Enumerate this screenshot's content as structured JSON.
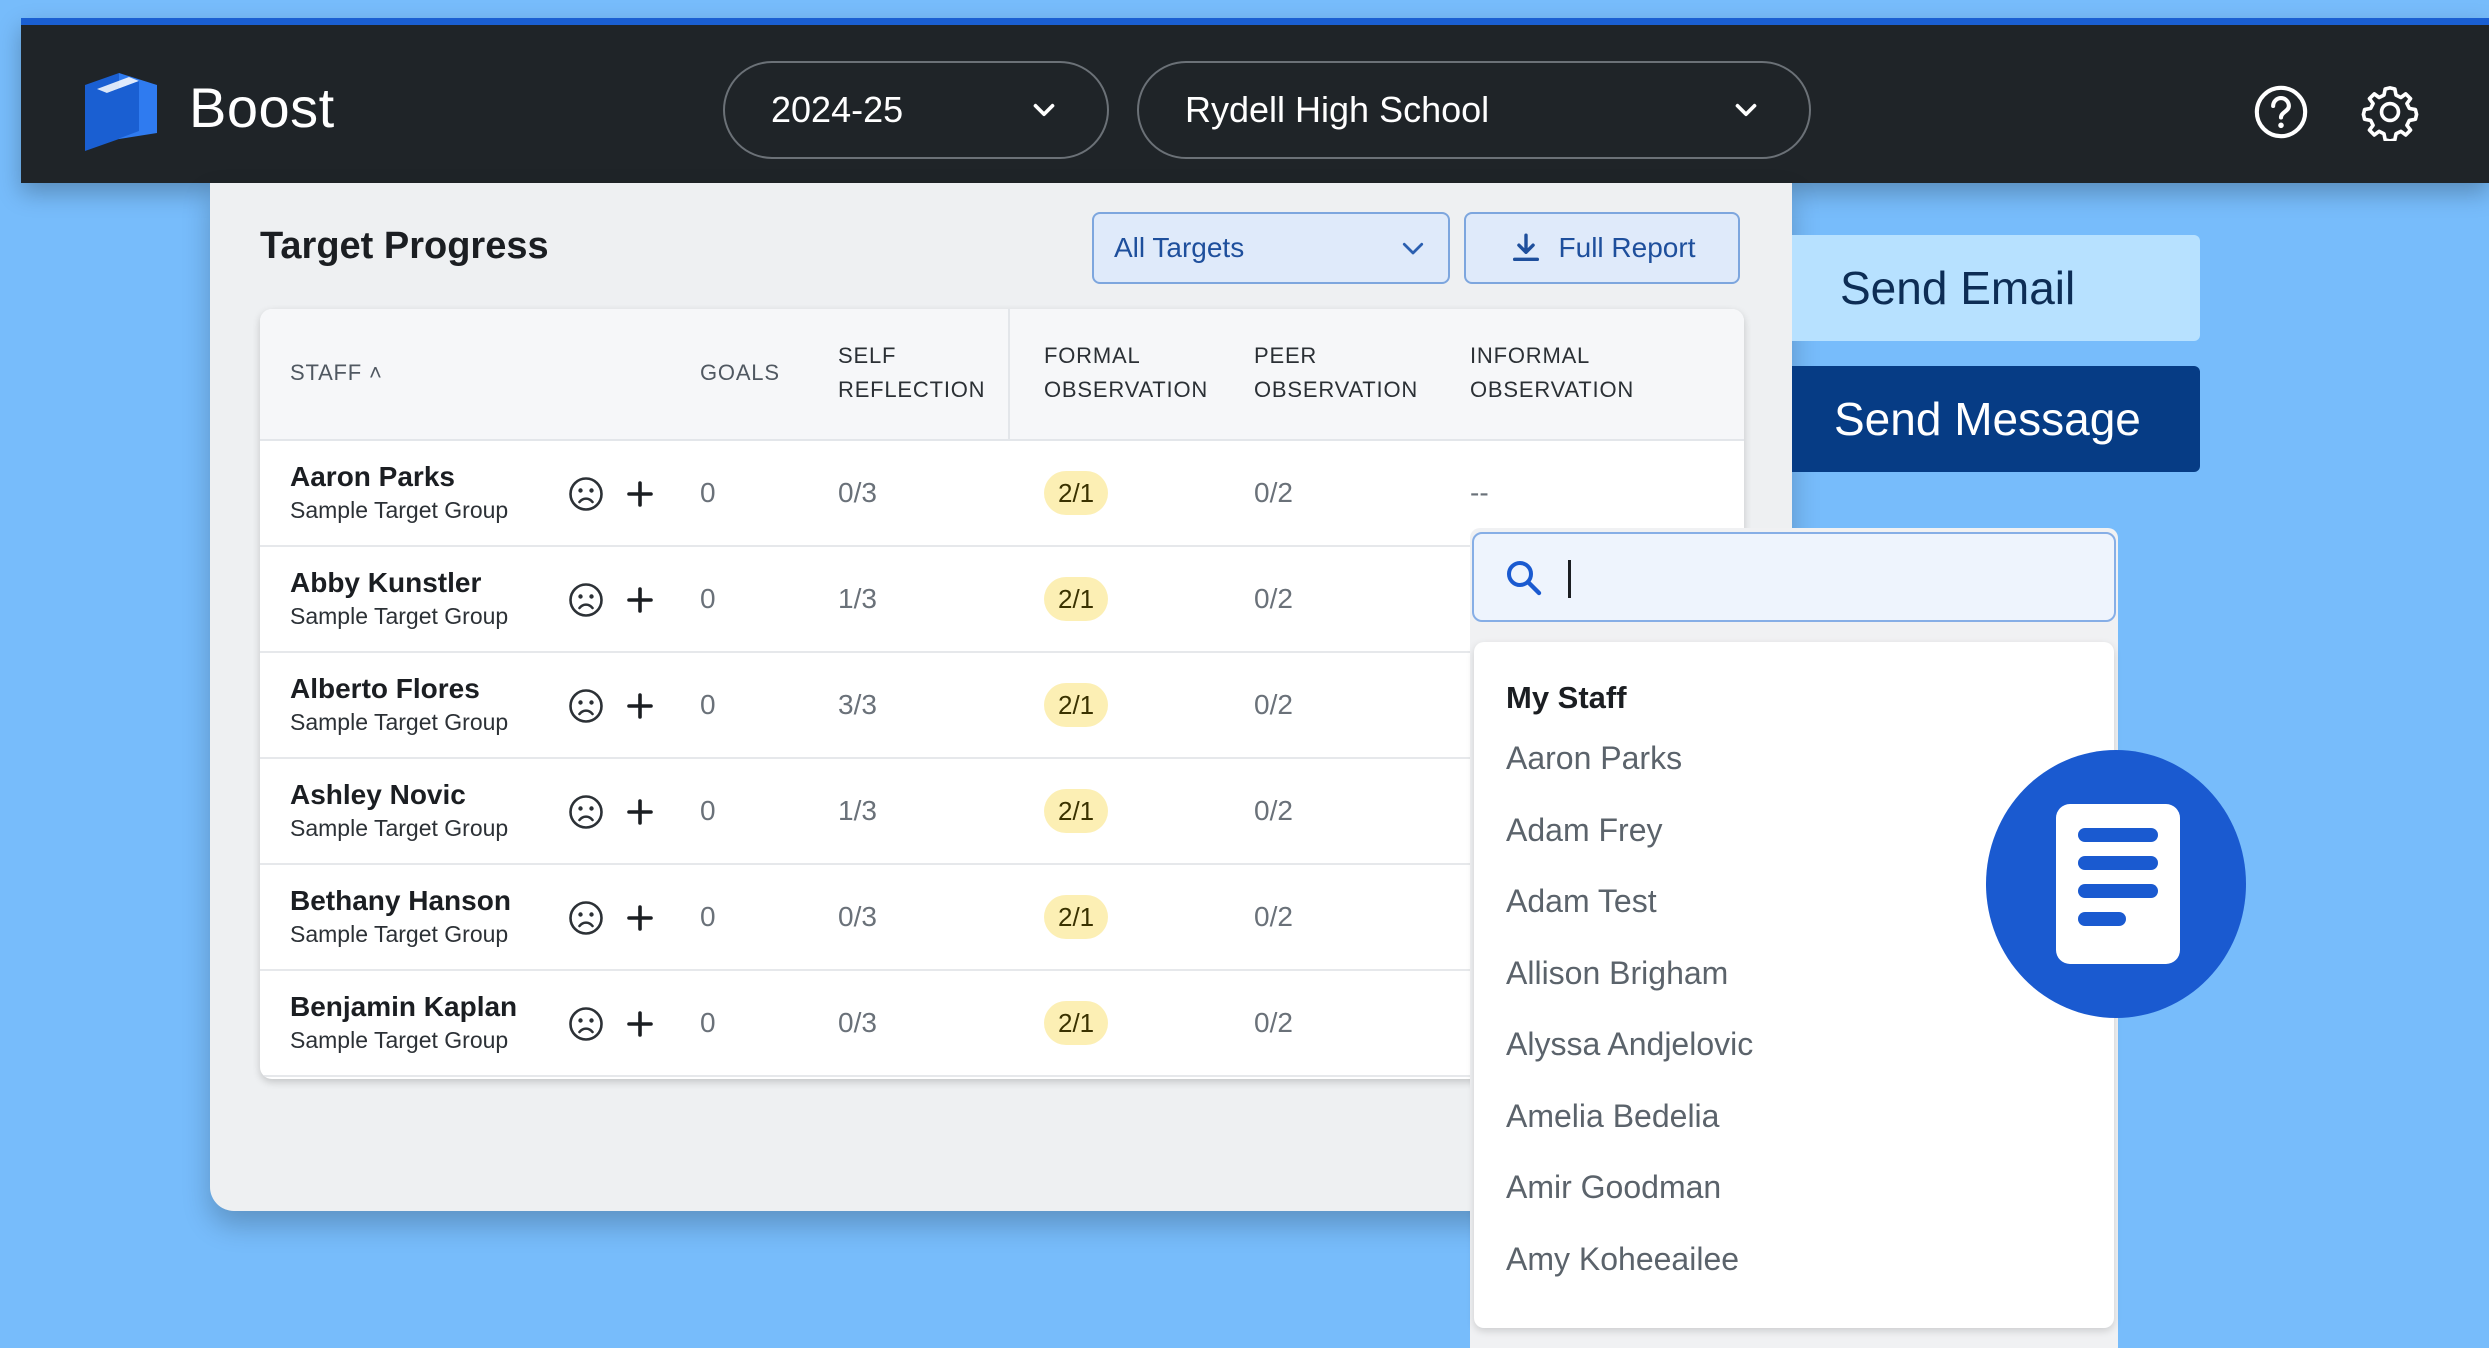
{
  "app": {
    "title": "Boost",
    "brand_color": "#1a5fd2"
  },
  "header": {
    "year_select": "2024-25",
    "school_select": "Rydell High School",
    "help_icon": "help-circle-icon",
    "settings_icon": "gear-icon"
  },
  "panel": {
    "title": "Target Progress",
    "filter_value": "All Targets",
    "report_label": "Full Report"
  },
  "table": {
    "columns": {
      "staff": "STAFF ˄",
      "goals": "GOALS",
      "self_reflection_1": "SELF",
      "self_reflection_2": "REFLECTION",
      "formal_1": "FORMAL",
      "formal_2": "OBSERVATION",
      "peer_1": "PEER",
      "peer_2": "OBSERVATION",
      "informal_1": "INFORMAL",
      "informal_2": "OBSERVATION"
    },
    "rows": [
      {
        "name": "Aaron Parks",
        "group": "Sample Target Group",
        "goals": "0",
        "self": "0/3",
        "formal": "2/1",
        "peer": "0/2",
        "informal": "--"
      },
      {
        "name": "Abby Kunstler",
        "group": "Sample Target Group",
        "goals": "0",
        "self": "1/3",
        "formal": "2/1",
        "peer": "0/2",
        "informal": ""
      },
      {
        "name": "Alberto Flores",
        "group": "Sample Target Group",
        "goals": "0",
        "self": "3/3",
        "formal": "2/1",
        "peer": "0/2",
        "informal": ""
      },
      {
        "name": "Ashley Novic",
        "group": "Sample Target Group",
        "goals": "0",
        "self": "1/3",
        "formal": "2/1",
        "peer": "0/2",
        "informal": ""
      },
      {
        "name": "Bethany Hanson",
        "group": "Sample Target Group",
        "goals": "0",
        "self": "0/3",
        "formal": "2/1",
        "peer": "0/2",
        "informal": ""
      },
      {
        "name": "Benjamin Kaplan",
        "group": "Sample Target Group",
        "goals": "0",
        "self": "0/3",
        "formal": "2/1",
        "peer": "0/2",
        "informal": ""
      }
    ]
  },
  "actions": {
    "send_email": "Send Email",
    "send_message": "Send Message"
  },
  "staff_search": {
    "value": "",
    "heading": "My Staff",
    "items": [
      "Aaron Parks",
      "Adam Frey",
      "Adam Test",
      "Allison Brigham",
      "Alyssa Andjelovic",
      "Amelia Bedelia",
      "Amir Goodman",
      "Amy Koheeailee"
    ]
  }
}
